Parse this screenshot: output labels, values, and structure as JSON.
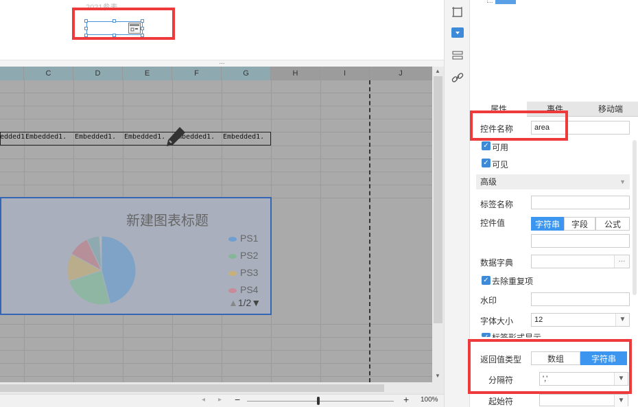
{
  "canvas": {
    "ghost_label": "2021参表"
  },
  "splitter": {
    "dots": "..."
  },
  "sheet": {
    "columns": [
      "C",
      "D",
      "E",
      "F",
      "G",
      "H",
      "I",
      "J"
    ],
    "cells": [
      "edded1.",
      "Embedded1.",
      "Embedded1.",
      "Embedded1.",
      "Embedded1.",
      "Embedded1."
    ]
  },
  "chart_data": {
    "type": "pie",
    "title": "新建图表标题",
    "categories": [
      "PS1",
      "PS2",
      "PS3",
      "PS4"
    ],
    "values": [
      46,
      24,
      13,
      10,
      6,
      1
    ],
    "colors": [
      "#7ea3c6",
      "#8fb6a3",
      "#b9ad8c",
      "#b68f99",
      "#8eaab0",
      "#b5b5b5"
    ],
    "legend": [
      {
        "name": "PS1",
        "color": "#6f9ed0"
      },
      {
        "name": "PS2",
        "color": "#86b79b"
      },
      {
        "name": "PS3",
        "color": "#c9b07a"
      },
      {
        "name": "PS4",
        "color": "#c98a99"
      }
    ],
    "pager": "1/2",
    "legend_position": "right"
  },
  "status": {
    "zoom": "100%",
    "minus": "−",
    "plus": "+"
  },
  "panel": {
    "tabs": [
      "属性",
      "事件",
      "移动端"
    ],
    "control_name_label": "控件名称",
    "control_name_value": "area",
    "enabled_label": "可用",
    "visible_label": "可见",
    "advanced_label": "高级",
    "tag_name_label": "标签名称",
    "control_value_label": "控件值",
    "value_modes": [
      "字符串",
      "字段",
      "公式"
    ],
    "data_dict_label": "数据字典",
    "data_dict_btn": "···",
    "dedupe_label": "去除重复项",
    "watermark_label": "水印",
    "font_size_label": "字体大小",
    "font_size_value": "12",
    "cut_label": "标签形式显示",
    "return_type_label": "返回值类型",
    "return_types": [
      "数组",
      "字符串"
    ],
    "separator_label": "分隔符",
    "separator_value": "','",
    "start_label": "起始符"
  },
  "colors": {
    "accent": "#3c96f0",
    "highlight": "#ee3a3a"
  }
}
